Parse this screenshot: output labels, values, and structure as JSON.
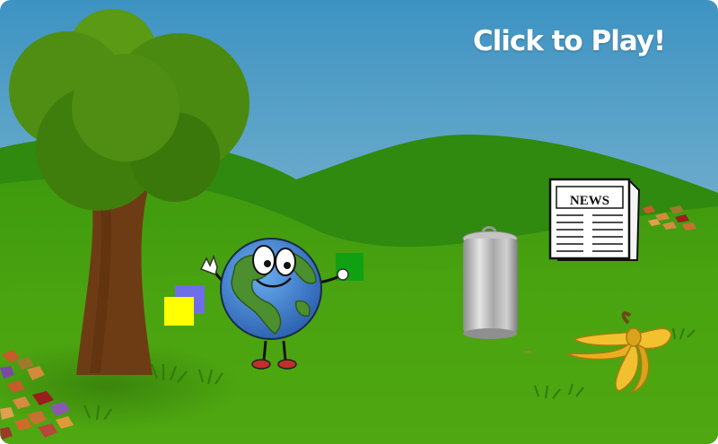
{
  "game": {
    "play_prompt": "Click to Play!",
    "newspaper_headline": "NEWS"
  },
  "colors": {
    "sky_top": "#3d93c2",
    "sky_bottom": "#9ec3d5",
    "hill_back": "#2f8a0f",
    "hill_front": "#3e9c0c",
    "ground": "#4aa410",
    "tree_leaves": "#4f8e12",
    "tree_trunk": "#6e3c14",
    "square_blue": "#6e6ee8",
    "square_yellow": "#ffff00",
    "square_green": "#11a011",
    "earth_ocean": "#3a7fd0",
    "earth_land": "#4c8f2e",
    "can_silver": "#b9b9b9",
    "banana_yellow": "#f2c12e"
  },
  "sprites": [
    "tree",
    "earth-mascot",
    "blue-square",
    "yellow-square",
    "green-square",
    "aluminum-can",
    "newspaper",
    "banana-peel",
    "fallen-leaves",
    "grass-tufts"
  ]
}
